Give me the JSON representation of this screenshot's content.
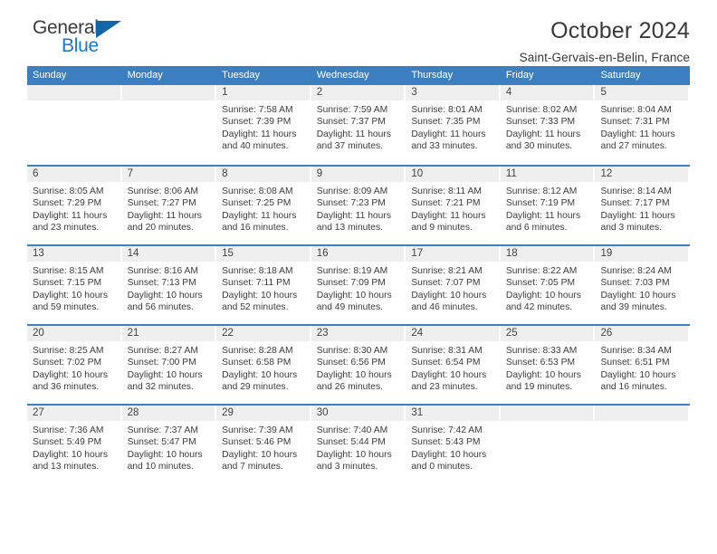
{
  "brand": {
    "name_top": "General",
    "name_bottom": "Blue",
    "accent_color": "#1b79c4",
    "triangle_color": "#1266a8"
  },
  "header": {
    "title": "October 2024",
    "location": "Saint-Gervais-en-Belin, France"
  },
  "theme": {
    "header_row_bg": "#3c7fc1",
    "daynum_bg": "#efefef",
    "text_color": "#3c3c3c"
  },
  "labels": {
    "sunrise_prefix": "Sunrise:",
    "sunset_prefix": "Sunset:",
    "daylight_prefix": "Daylight:"
  },
  "weekdays": [
    "Sunday",
    "Monday",
    "Tuesday",
    "Wednesday",
    "Thursday",
    "Friday",
    "Saturday"
  ],
  "weeks": [
    [
      {
        "day": "",
        "sunrise": "",
        "sunset": "",
        "daylight": ""
      },
      {
        "day": "",
        "sunrise": "",
        "sunset": "",
        "daylight": ""
      },
      {
        "day": "1",
        "sunrise": "Sunrise: 7:58 AM",
        "sunset": "Sunset: 7:39 PM",
        "daylight": "Daylight: 11 hours and 40 minutes."
      },
      {
        "day": "2",
        "sunrise": "Sunrise: 7:59 AM",
        "sunset": "Sunset: 7:37 PM",
        "daylight": "Daylight: 11 hours and 37 minutes."
      },
      {
        "day": "3",
        "sunrise": "Sunrise: 8:01 AM",
        "sunset": "Sunset: 7:35 PM",
        "daylight": "Daylight: 11 hours and 33 minutes."
      },
      {
        "day": "4",
        "sunrise": "Sunrise: 8:02 AM",
        "sunset": "Sunset: 7:33 PM",
        "daylight": "Daylight: 11 hours and 30 minutes."
      },
      {
        "day": "5",
        "sunrise": "Sunrise: 8:04 AM",
        "sunset": "Sunset: 7:31 PM",
        "daylight": "Daylight: 11 hours and 27 minutes."
      }
    ],
    [
      {
        "day": "6",
        "sunrise": "Sunrise: 8:05 AM",
        "sunset": "Sunset: 7:29 PM",
        "daylight": "Daylight: 11 hours and 23 minutes."
      },
      {
        "day": "7",
        "sunrise": "Sunrise: 8:06 AM",
        "sunset": "Sunset: 7:27 PM",
        "daylight": "Daylight: 11 hours and 20 minutes."
      },
      {
        "day": "8",
        "sunrise": "Sunrise: 8:08 AM",
        "sunset": "Sunset: 7:25 PM",
        "daylight": "Daylight: 11 hours and 16 minutes."
      },
      {
        "day": "9",
        "sunrise": "Sunrise: 8:09 AM",
        "sunset": "Sunset: 7:23 PM",
        "daylight": "Daylight: 11 hours and 13 minutes."
      },
      {
        "day": "10",
        "sunrise": "Sunrise: 8:11 AM",
        "sunset": "Sunset: 7:21 PM",
        "daylight": "Daylight: 11 hours and 9 minutes."
      },
      {
        "day": "11",
        "sunrise": "Sunrise: 8:12 AM",
        "sunset": "Sunset: 7:19 PM",
        "daylight": "Daylight: 11 hours and 6 minutes."
      },
      {
        "day": "12",
        "sunrise": "Sunrise: 8:14 AM",
        "sunset": "Sunset: 7:17 PM",
        "daylight": "Daylight: 11 hours and 3 minutes."
      }
    ],
    [
      {
        "day": "13",
        "sunrise": "Sunrise: 8:15 AM",
        "sunset": "Sunset: 7:15 PM",
        "daylight": "Daylight: 10 hours and 59 minutes."
      },
      {
        "day": "14",
        "sunrise": "Sunrise: 8:16 AM",
        "sunset": "Sunset: 7:13 PM",
        "daylight": "Daylight: 10 hours and 56 minutes."
      },
      {
        "day": "15",
        "sunrise": "Sunrise: 8:18 AM",
        "sunset": "Sunset: 7:11 PM",
        "daylight": "Daylight: 10 hours and 52 minutes."
      },
      {
        "day": "16",
        "sunrise": "Sunrise: 8:19 AM",
        "sunset": "Sunset: 7:09 PM",
        "daylight": "Daylight: 10 hours and 49 minutes."
      },
      {
        "day": "17",
        "sunrise": "Sunrise: 8:21 AM",
        "sunset": "Sunset: 7:07 PM",
        "daylight": "Daylight: 10 hours and 46 minutes."
      },
      {
        "day": "18",
        "sunrise": "Sunrise: 8:22 AM",
        "sunset": "Sunset: 7:05 PM",
        "daylight": "Daylight: 10 hours and 42 minutes."
      },
      {
        "day": "19",
        "sunrise": "Sunrise: 8:24 AM",
        "sunset": "Sunset: 7:03 PM",
        "daylight": "Daylight: 10 hours and 39 minutes."
      }
    ],
    [
      {
        "day": "20",
        "sunrise": "Sunrise: 8:25 AM",
        "sunset": "Sunset: 7:02 PM",
        "daylight": "Daylight: 10 hours and 36 minutes."
      },
      {
        "day": "21",
        "sunrise": "Sunrise: 8:27 AM",
        "sunset": "Sunset: 7:00 PM",
        "daylight": "Daylight: 10 hours and 32 minutes."
      },
      {
        "day": "22",
        "sunrise": "Sunrise: 8:28 AM",
        "sunset": "Sunset: 6:58 PM",
        "daylight": "Daylight: 10 hours and 29 minutes."
      },
      {
        "day": "23",
        "sunrise": "Sunrise: 8:30 AM",
        "sunset": "Sunset: 6:56 PM",
        "daylight": "Daylight: 10 hours and 26 minutes."
      },
      {
        "day": "24",
        "sunrise": "Sunrise: 8:31 AM",
        "sunset": "Sunset: 6:54 PM",
        "daylight": "Daylight: 10 hours and 23 minutes."
      },
      {
        "day": "25",
        "sunrise": "Sunrise: 8:33 AM",
        "sunset": "Sunset: 6:53 PM",
        "daylight": "Daylight: 10 hours and 19 minutes."
      },
      {
        "day": "26",
        "sunrise": "Sunrise: 8:34 AM",
        "sunset": "Sunset: 6:51 PM",
        "daylight": "Daylight: 10 hours and 16 minutes."
      }
    ],
    [
      {
        "day": "27",
        "sunrise": "Sunrise: 7:36 AM",
        "sunset": "Sunset: 5:49 PM",
        "daylight": "Daylight: 10 hours and 13 minutes."
      },
      {
        "day": "28",
        "sunrise": "Sunrise: 7:37 AM",
        "sunset": "Sunset: 5:47 PM",
        "daylight": "Daylight: 10 hours and 10 minutes."
      },
      {
        "day": "29",
        "sunrise": "Sunrise: 7:39 AM",
        "sunset": "Sunset: 5:46 PM",
        "daylight": "Daylight: 10 hours and 7 minutes."
      },
      {
        "day": "30",
        "sunrise": "Sunrise: 7:40 AM",
        "sunset": "Sunset: 5:44 PM",
        "daylight": "Daylight: 10 hours and 3 minutes."
      },
      {
        "day": "31",
        "sunrise": "Sunrise: 7:42 AM",
        "sunset": "Sunset: 5:43 PM",
        "daylight": "Daylight: 10 hours and 0 minutes."
      },
      {
        "day": "",
        "sunrise": "",
        "sunset": "",
        "daylight": ""
      },
      {
        "day": "",
        "sunrise": "",
        "sunset": "",
        "daylight": ""
      }
    ]
  ]
}
